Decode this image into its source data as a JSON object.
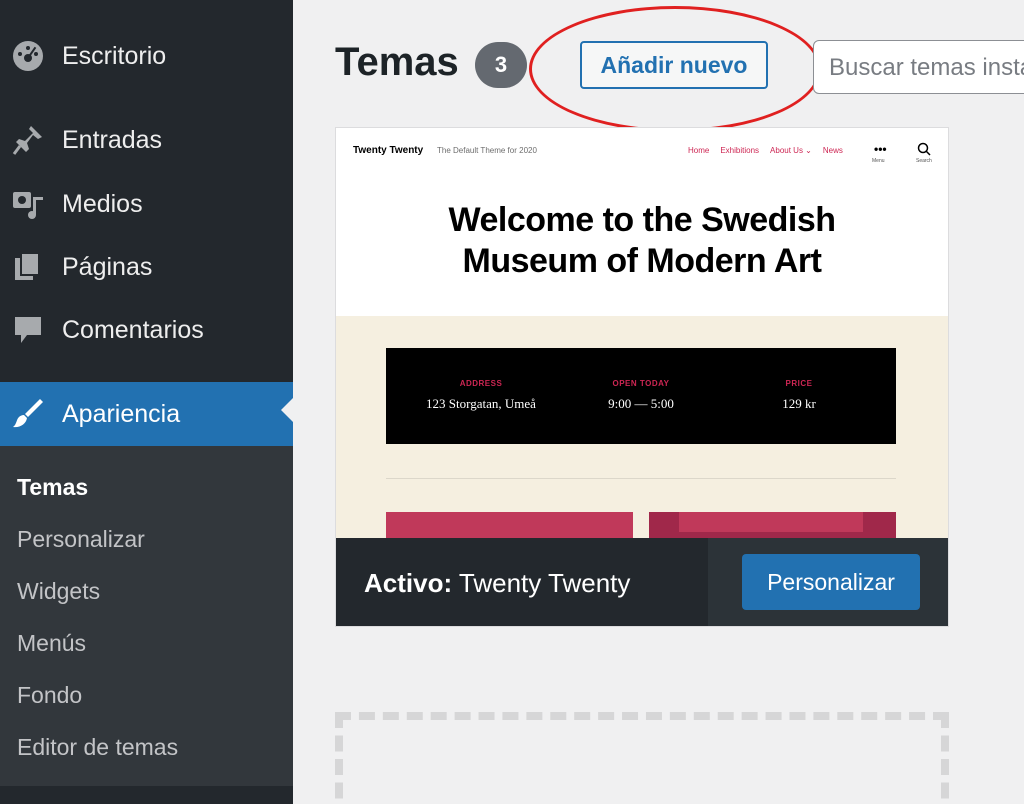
{
  "sidebar": {
    "items": [
      {
        "label": "Escritorio",
        "icon": "dashboard-icon"
      },
      {
        "label": "Entradas",
        "icon": "pin-icon"
      },
      {
        "label": "Medios",
        "icon": "media-icon"
      },
      {
        "label": "Páginas",
        "icon": "pages-icon"
      },
      {
        "label": "Comentarios",
        "icon": "comments-icon"
      },
      {
        "label": "Apariencia",
        "icon": "brush-icon",
        "active": true
      }
    ],
    "submenu": [
      "Temas",
      "Personalizar",
      "Widgets",
      "Menús",
      "Fondo",
      "Editor de temas"
    ],
    "current_submenu": "Temas"
  },
  "header": {
    "title": "Temas",
    "count": "3",
    "add_button": "Añadir nuevo",
    "search_placeholder": "Buscar temas instalados..."
  },
  "theme": {
    "preview": {
      "site_title": "Twenty Twenty",
      "tagline": "The Default Theme for 2020",
      "nav": [
        "Home",
        "Exhibitions",
        "About Us ⌄",
        "News"
      ],
      "menu_caption": "Menu",
      "search_caption": "Search",
      "hero_line1": "Welcome to the Swedish",
      "hero_line2": "Museum of Modern Art",
      "info": [
        {
          "label": "ADDRESS",
          "value": "123 Storgatan, Umeå"
        },
        {
          "label": "OPEN TODAY",
          "value": "9:00 — 5:00"
        },
        {
          "label": "PRICE",
          "value": "129 kr"
        }
      ]
    },
    "active_prefix": "Activo:",
    "active_name": "Twenty Twenty",
    "customize_button": "Personalizar"
  },
  "colors": {
    "sidebar_bg": "#23282d",
    "accent": "#2271b1",
    "theme_accent": "#cd2653",
    "highlight": "#e02020"
  }
}
